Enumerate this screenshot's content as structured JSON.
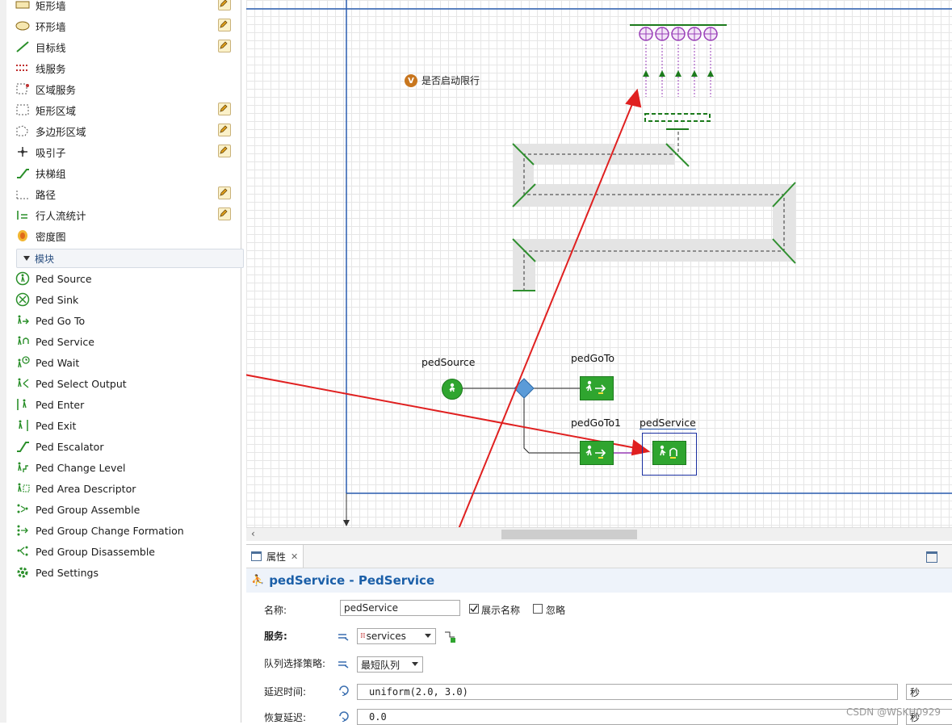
{
  "palette": {
    "items_top": [
      {
        "label": "矩形墙",
        "icon": "rect-wall-icon",
        "editable": true
      },
      {
        "label": "环形墙",
        "icon": "ring-wall-icon",
        "editable": true
      },
      {
        "label": "目标线",
        "icon": "target-line-icon",
        "editable": true
      },
      {
        "label": "线服务",
        "icon": "line-service-icon",
        "editable": false
      },
      {
        "label": "区域服务",
        "icon": "area-service-icon",
        "editable": false
      },
      {
        "label": "矩形区域",
        "icon": "rect-area-icon",
        "editable": true
      },
      {
        "label": "多边形区域",
        "icon": "polygon-area-icon",
        "editable": true
      },
      {
        "label": "吸引子",
        "icon": "attractor-icon",
        "editable": true
      },
      {
        "label": "扶梯组",
        "icon": "escalator-group-icon",
        "editable": false
      },
      {
        "label": "路径",
        "icon": "path-icon",
        "editable": true
      },
      {
        "label": "行人流统计",
        "icon": "ped-flow-stats-icon",
        "editable": true
      },
      {
        "label": "密度图",
        "icon": "density-map-icon",
        "editable": false
      }
    ],
    "section_label": "模块",
    "blocks": [
      {
        "label": "Ped Source",
        "icon": "ped-source-icon"
      },
      {
        "label": "Ped Sink",
        "icon": "ped-sink-icon"
      },
      {
        "label": "Ped Go To",
        "icon": "ped-go-to-icon"
      },
      {
        "label": "Ped Service",
        "icon": "ped-service-icon"
      },
      {
        "label": "Ped Wait",
        "icon": "ped-wait-icon"
      },
      {
        "label": "Ped Select Output",
        "icon": "ped-select-output-icon"
      },
      {
        "label": "Ped Enter",
        "icon": "ped-enter-icon"
      },
      {
        "label": "Ped Exit",
        "icon": "ped-exit-icon"
      },
      {
        "label": "Ped Escalator",
        "icon": "ped-escalator-icon"
      },
      {
        "label": "Ped Change Level",
        "icon": "ped-change-level-icon"
      },
      {
        "label": "Ped Area Descriptor",
        "icon": "ped-area-descriptor-icon"
      },
      {
        "label": "Ped Group Assemble",
        "icon": "ped-group-assemble-icon"
      },
      {
        "label": "Ped Group Change Formation",
        "icon": "ped-group-change-formation-icon"
      },
      {
        "label": "Ped Group Disassemble",
        "icon": "ped-group-disassemble-icon"
      },
      {
        "label": "Ped Settings",
        "icon": "ped-settings-icon"
      }
    ]
  },
  "canvas": {
    "variable_badge": "V",
    "variable_label": "是否启动限行",
    "nodes": {
      "ped_source": "pedSource",
      "ped_go_to": "pedGoTo",
      "ped_go_to_1": "pedGoTo1",
      "ped_service": "pedService"
    }
  },
  "properties": {
    "tab_label": "属性",
    "title": "pedService - PedService",
    "name_label": "名称:",
    "name_value": "pedService",
    "show_name_label": "展示名称",
    "show_name_checked": true,
    "ignore_label": "忽略",
    "ignore_checked": false,
    "service_label": "服务:",
    "service_value": "services",
    "queue_policy_label": "队列选择策略:",
    "queue_policy_value": "最短队列",
    "delay_label": "延迟时间:",
    "delay_value": "uniform(2.0, 3.0)",
    "delay_unit": "秒",
    "recovery_label": "恢复延迟:",
    "recovery_value": "0.0",
    "recovery_unit": "秒"
  },
  "watermark": "CSDN @WSKH0929",
  "colors": {
    "accent_blue": "#1b5fa8",
    "block_green": "#2fa52f",
    "annotation_red": "#e02020",
    "wall_gray": "#e4e4e4"
  }
}
